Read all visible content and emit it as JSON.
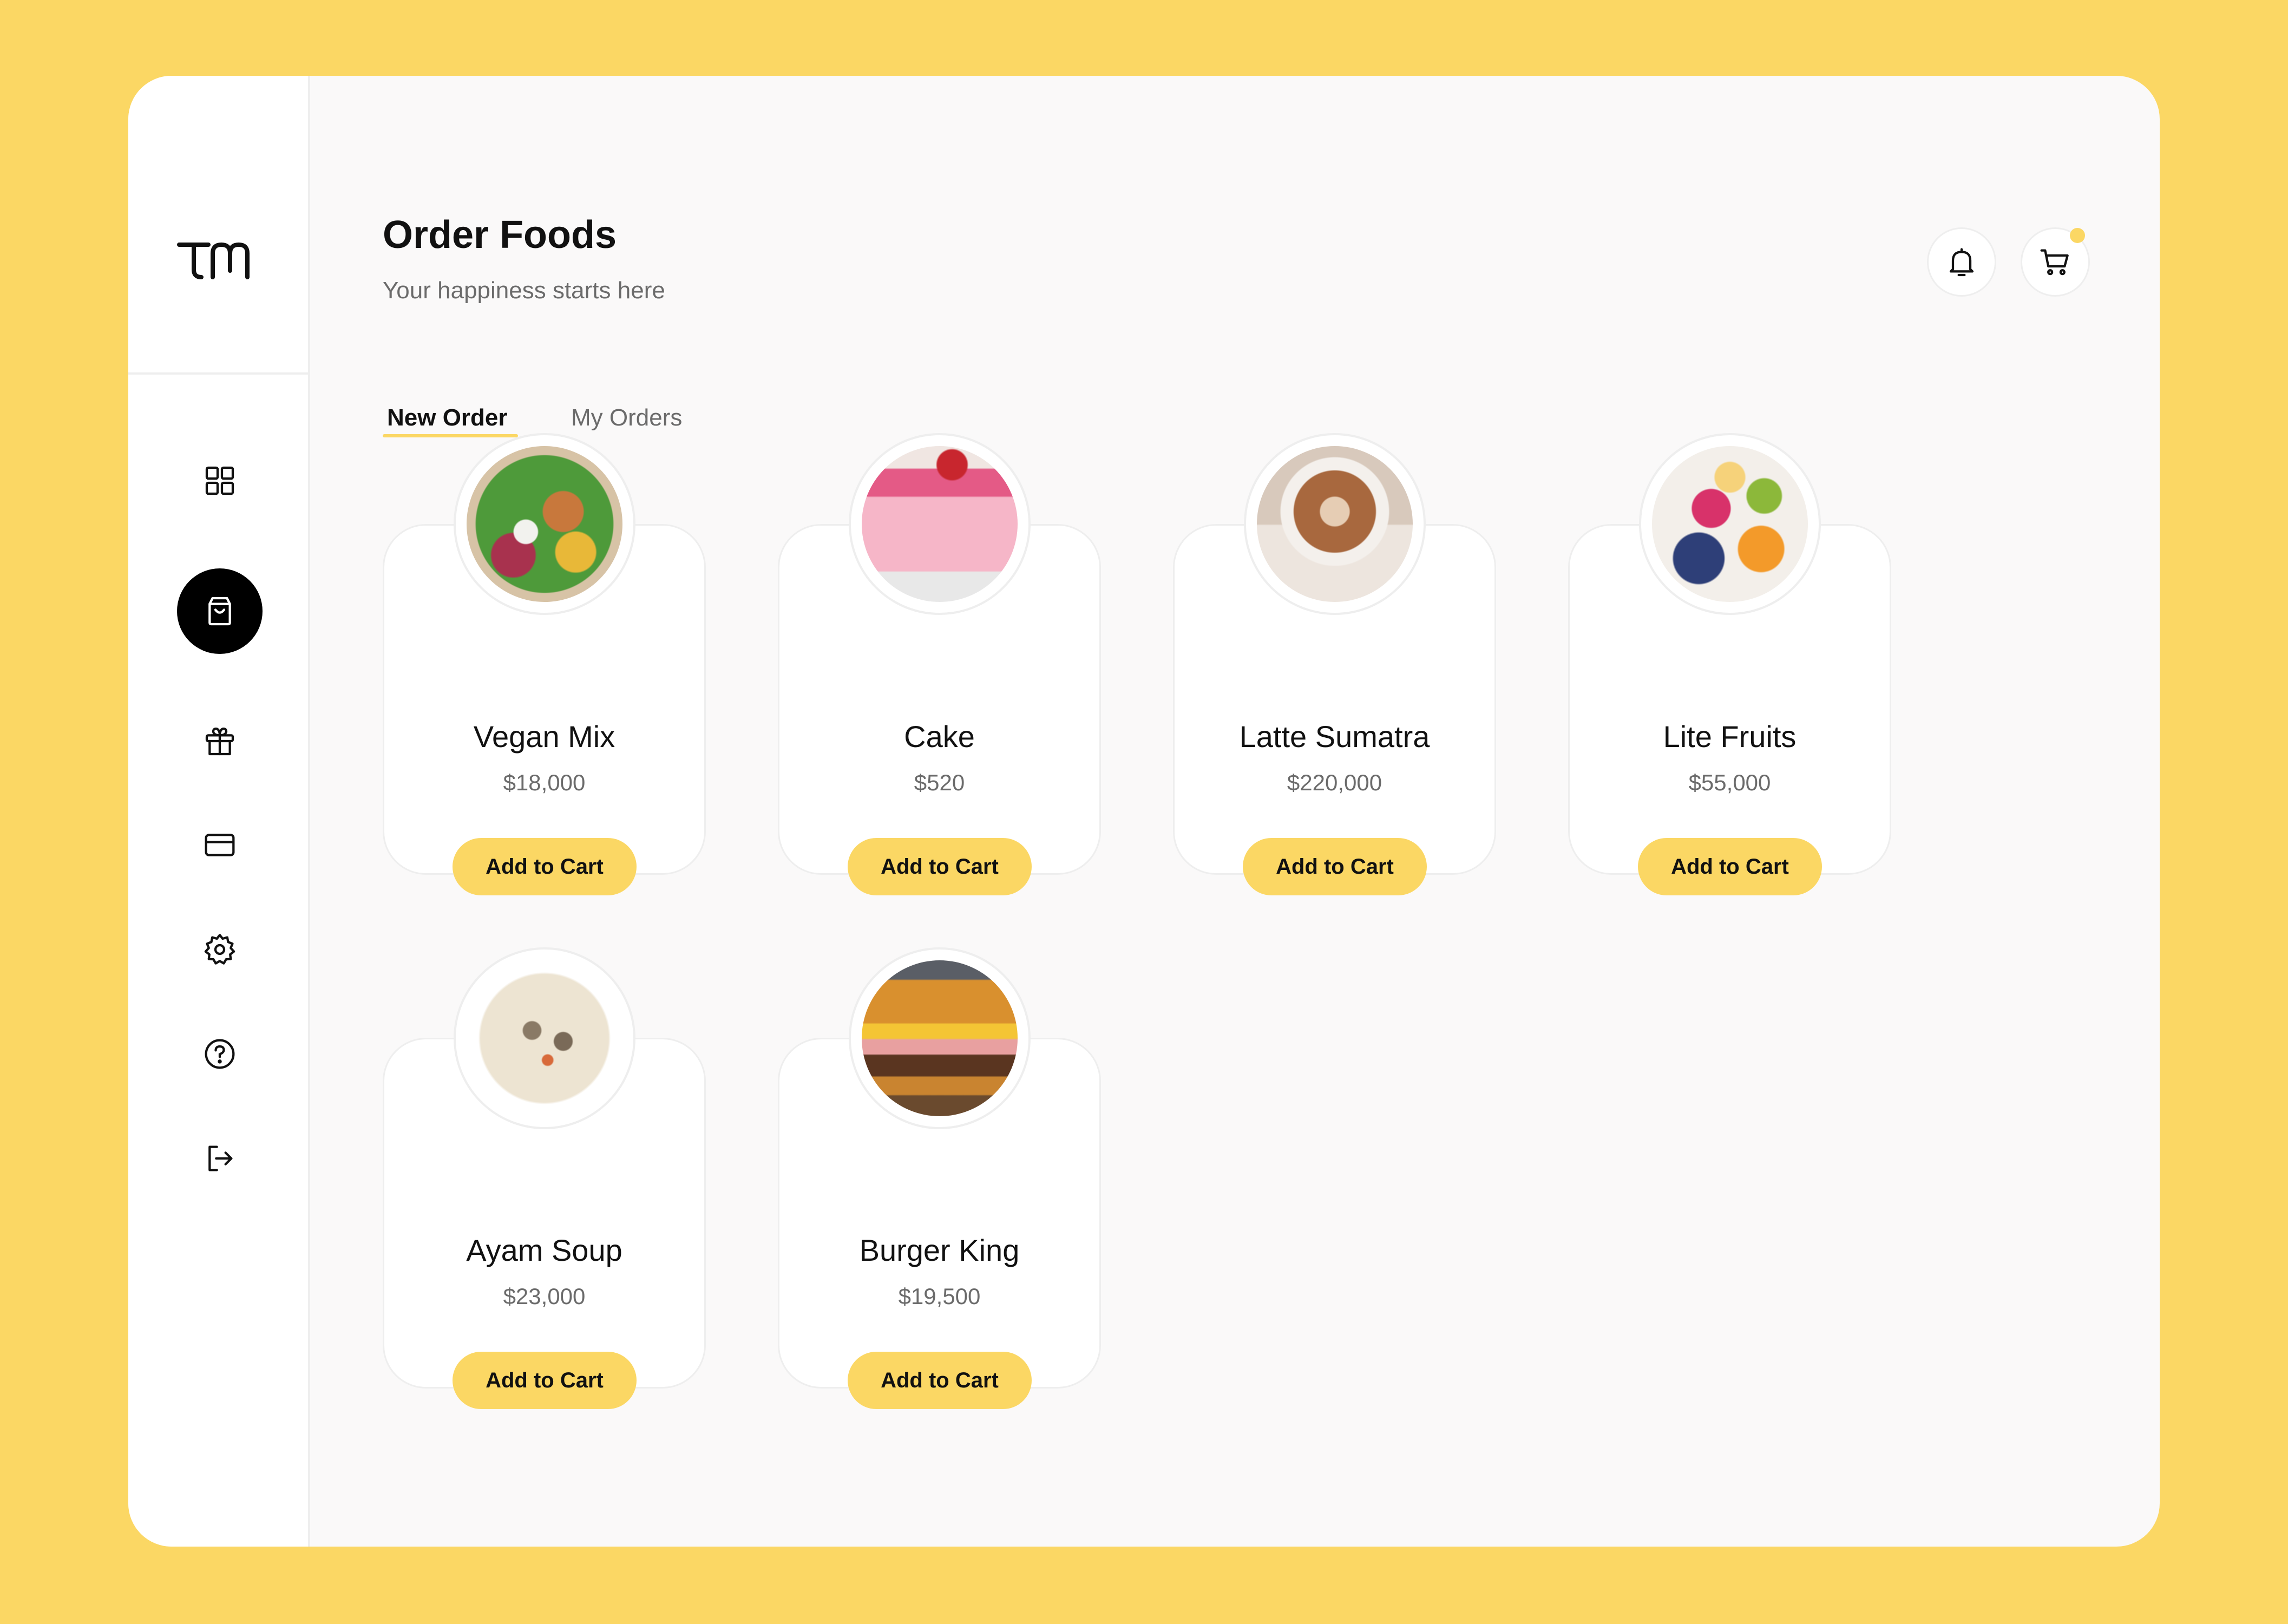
{
  "app": {
    "logo_text": "TM"
  },
  "sidebar": {
    "items": [
      {
        "name": "dashboard-icon",
        "active": false
      },
      {
        "name": "shopping-bag-icon",
        "active": true
      },
      {
        "name": "gift-icon",
        "active": false
      },
      {
        "name": "credit-card-icon",
        "active": false
      },
      {
        "name": "settings-icon",
        "active": false
      },
      {
        "name": "help-icon",
        "active": false
      },
      {
        "name": "logout-icon",
        "active": false
      }
    ]
  },
  "header": {
    "title": "Order Foods",
    "subtitle": "Your happiness starts here",
    "notification_icon": "bell-icon",
    "cart_icon": "cart-icon",
    "cart_has_badge": true
  },
  "tabs": [
    {
      "label": "New Order",
      "active": true
    },
    {
      "label": "My Orders",
      "active": false
    }
  ],
  "products": [
    {
      "name": "Vegan Mix",
      "price": "$18,000",
      "button_label": "Add to Cart"
    },
    {
      "name": "Cake",
      "price": "$520",
      "button_label": "Add to Cart"
    },
    {
      "name": "Latte Sumatra",
      "price": "$220,000",
      "button_label": "Add to Cart"
    },
    {
      "name": "Lite Fruits",
      "price": "$55,000",
      "button_label": "Add to Cart"
    },
    {
      "name": "Ayam Soup",
      "price": "$23,000",
      "button_label": "Add to Cart"
    },
    {
      "name": "Burger King",
      "price": "$19,500",
      "button_label": "Add to Cart"
    }
  ],
  "colors": {
    "accent": "#FBD764",
    "background": "#FAF9F9",
    "text_primary": "#111111",
    "text_secondary": "#6B6B6B"
  }
}
